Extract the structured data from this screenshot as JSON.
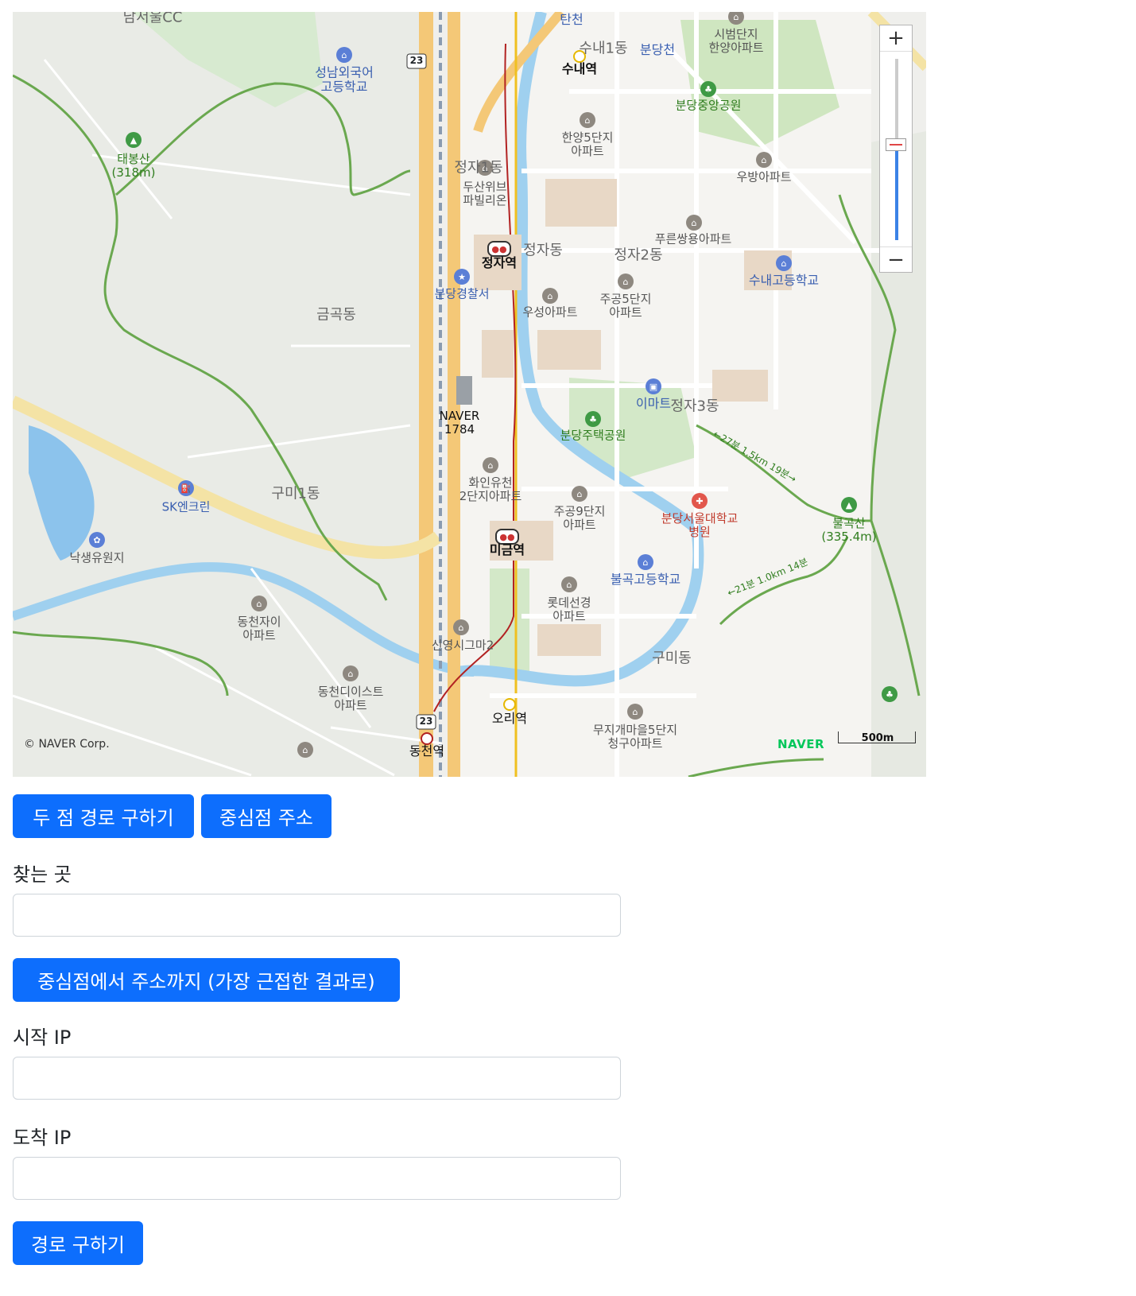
{
  "map": {
    "copyright": "© NAVER Corp.",
    "logo": "NAVER",
    "scale_label": "500m",
    "zoom_in_label": "+",
    "zoom_out_label": "−",
    "labels": {
      "namseoul_cc": "남서울CC",
      "seongnam_school": "성남외국어\n고등학교",
      "taebongsan": "태봉산\n(318m)",
      "geumgok": "금곡동",
      "gumi1": "구미1동",
      "sk": "SK엔크린",
      "naksaeng": "낙생유원지",
      "dongcheon_xi": "동천자이\n아파트",
      "dongcheon_east": "동천디이스트\n아파트",
      "sinyeong": "신영시그마2",
      "naver1784": "NAVER\n1784",
      "police": "분당경찰서",
      "doosan": "두산위브\n파빌리온",
      "jeongja_dong_top": "정자1동",
      "jeongja_stn": "정자역",
      "jeongja_dong": "정자동",
      "jeongja2": "정자2동",
      "jeongja3": "정자3동",
      "woosung": "우성아파트",
      "jugong5": "주공5단지\n아파트",
      "hanyang5": "한양5단지\n아파트",
      "sunae1": "수내1동",
      "sunae_stn": "수내역",
      "bundangcheon": "분당천",
      "tancheon": "탄천",
      "sibeom": "시범단지\n한양아파트",
      "central_park": "분당중앙공원",
      "woobang": "우방아파트",
      "pureun": "푸른쌍용아파트",
      "sunae_school": "수내고등학교",
      "emart": "이마트",
      "housing_park": "분당주택공원",
      "hwain": "화인유천\n2단지아파트",
      "jugong9": "주공9단지\n아파트",
      "migeum_stn": "미금역",
      "snuh": "분당서울대학교\n병원",
      "bulgok_school": "불곡고등학교",
      "lotte": "롯데선경\n아파트",
      "gumi_dong": "구미동",
      "ori_stn": "오리역",
      "muji": "무지개마을5단지\n청구아파트",
      "bulgoksan": "불곡산\n(335.4m)",
      "dongcheon_stn": "동천역",
      "route_badge": "23",
      "trail1": "←27분 1.5km 19분→",
      "trail2": "←21분 1.0km 14분"
    }
  },
  "buttons": {
    "route_two_points": "두 점 경로 구하기",
    "center_address": "중심점 주소",
    "center_to_address": "중심점에서 주소까지 (가장 근접한 결과로)",
    "find_route": "경로 구하기"
  },
  "form": {
    "search_label": "찾는 곳",
    "search_value": "",
    "start_ip_label": "시작 IP",
    "start_ip_value": "",
    "end_ip_label": "도착 IP",
    "end_ip_value": ""
  },
  "colors": {
    "primary": "#0d6efd",
    "map_bg": "#f2f1ee",
    "highway": "#f4c877",
    "river": "#9fd0ef",
    "park": "#cfe6c0",
    "trail": "#6aa84f"
  }
}
